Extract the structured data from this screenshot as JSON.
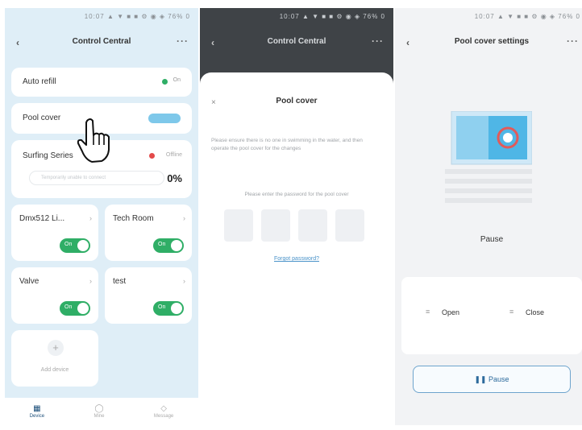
{
  "status_bar": {
    "text": "10:07 ▲ ▼ ■ ■    ⚙ ◉ ◈ 76% 0"
  },
  "colors": {
    "green": "#2fae66",
    "blue": "#6ea4cd",
    "red": "#e34a4a",
    "bg_blue": "#dfeef7"
  },
  "panel1": {
    "nav_title": "Control Central",
    "more": "···",
    "auto_refill": {
      "label": "Auto refill",
      "status": "On"
    },
    "pool_cover": {
      "label": "Pool cover"
    },
    "surfing": {
      "label": "Surfing Series",
      "status": "Offline",
      "placeholder": "Temporarily unable to connect",
      "value": "0%"
    },
    "devices": [
      {
        "label": "Dmx512 Li...",
        "toggle": "On"
      },
      {
        "label": "Tech Room",
        "toggle": "On"
      },
      {
        "label": "Valve",
        "toggle": "On"
      },
      {
        "label": "test",
        "toggle": "On"
      }
    ],
    "add_device": "Add device",
    "tabs": [
      {
        "label": "Device",
        "icon": "device-icon"
      },
      {
        "label": "Mine",
        "icon": "user-icon"
      },
      {
        "label": "Message",
        "icon": "message-icon"
      }
    ]
  },
  "panel2": {
    "nav_title": "Control Central",
    "sheet_title": "Pool cover",
    "notice": "Please ensure there is no one in swimming in the water, and then operate the pool cover for the changes",
    "prompt": "Please enter the password for the pool cover",
    "forgot": "Forgot password?"
  },
  "panel3": {
    "nav_title": "Pool cover settings",
    "status": "Pause",
    "open": "Open",
    "close": "Close",
    "pause_btn": "Pause"
  }
}
